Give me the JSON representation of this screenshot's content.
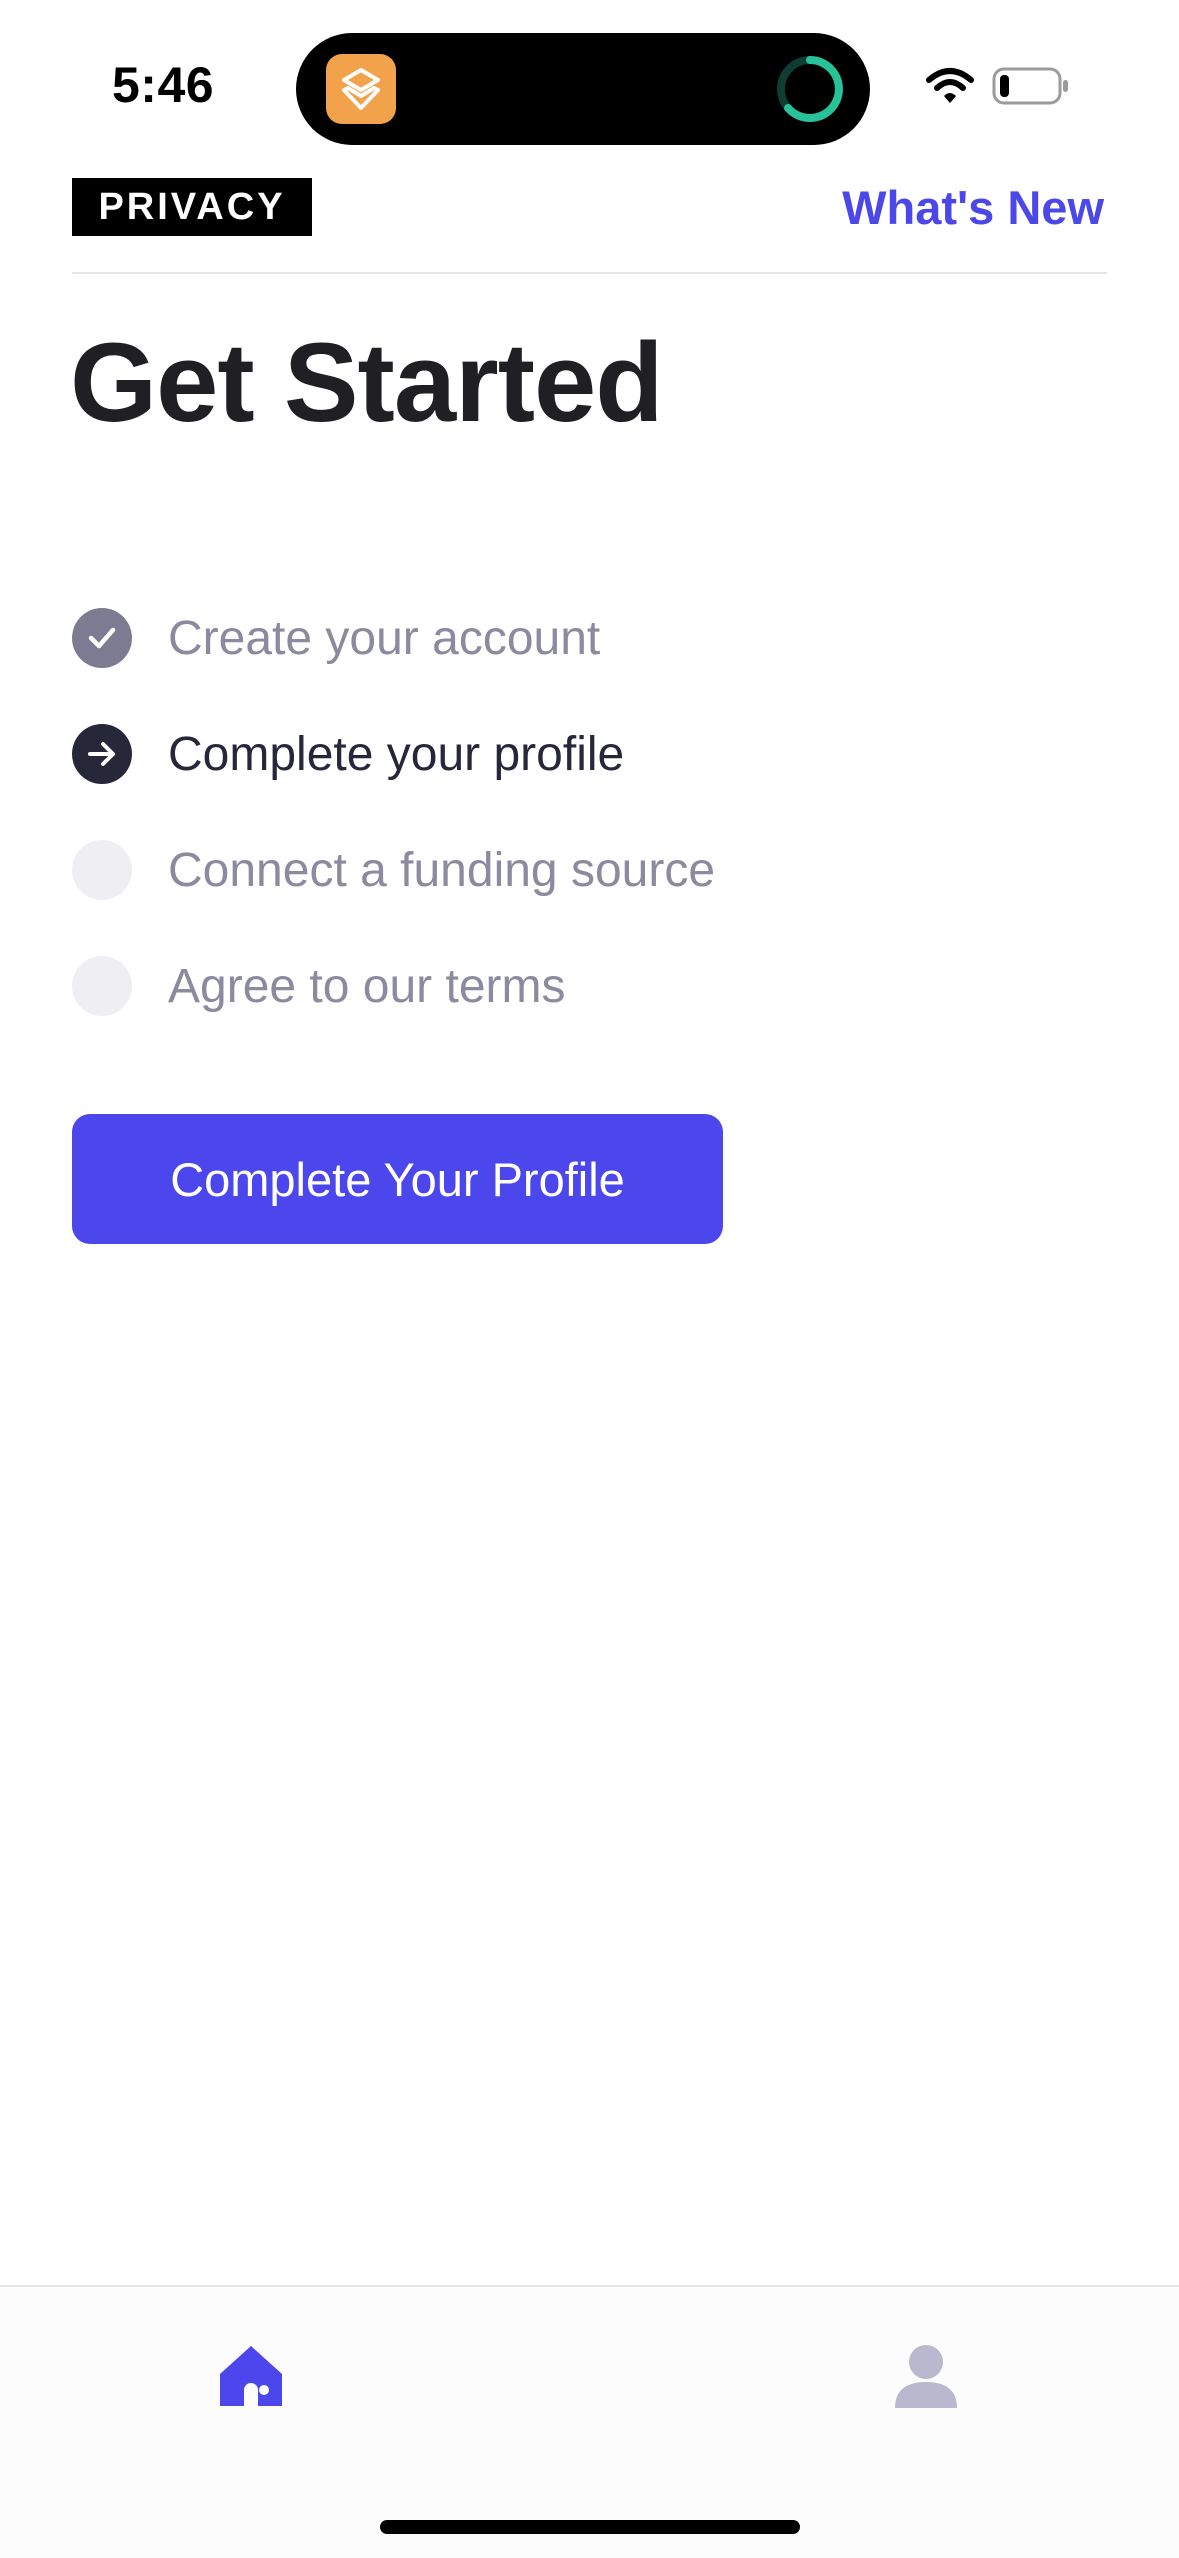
{
  "status_bar": {
    "time": "5:46",
    "app_icon": "shortcuts-icon",
    "activity_icon": "progress-ring-icon",
    "wifi_icon": "wifi-icon",
    "battery_icon": "battery-icon"
  },
  "header": {
    "brand": "PRIVACY",
    "whats_new": "What's New"
  },
  "title": "Get Started",
  "steps": [
    {
      "label": "Create your account",
      "state": "done",
      "icon": "checkmark-icon"
    },
    {
      "label": "Complete your profile",
      "state": "current",
      "icon": "arrow-right-icon"
    },
    {
      "label": "Connect a funding source",
      "state": "pending",
      "icon": ""
    },
    {
      "label": "Agree to our terms",
      "state": "pending",
      "icon": ""
    }
  ],
  "primary_button": {
    "label": "Complete Your Profile"
  },
  "tab_bar": {
    "items": [
      {
        "name": "home",
        "icon": "home-icon",
        "active": true
      },
      {
        "name": "profile",
        "icon": "person-icon",
        "active": false
      }
    ]
  },
  "colors": {
    "accent": "#4b47ed",
    "step_done": "#7c7b91",
    "step_current": "#27273a",
    "step_pending": "#efeff3",
    "tab_inactive": "#b9b8cf"
  }
}
